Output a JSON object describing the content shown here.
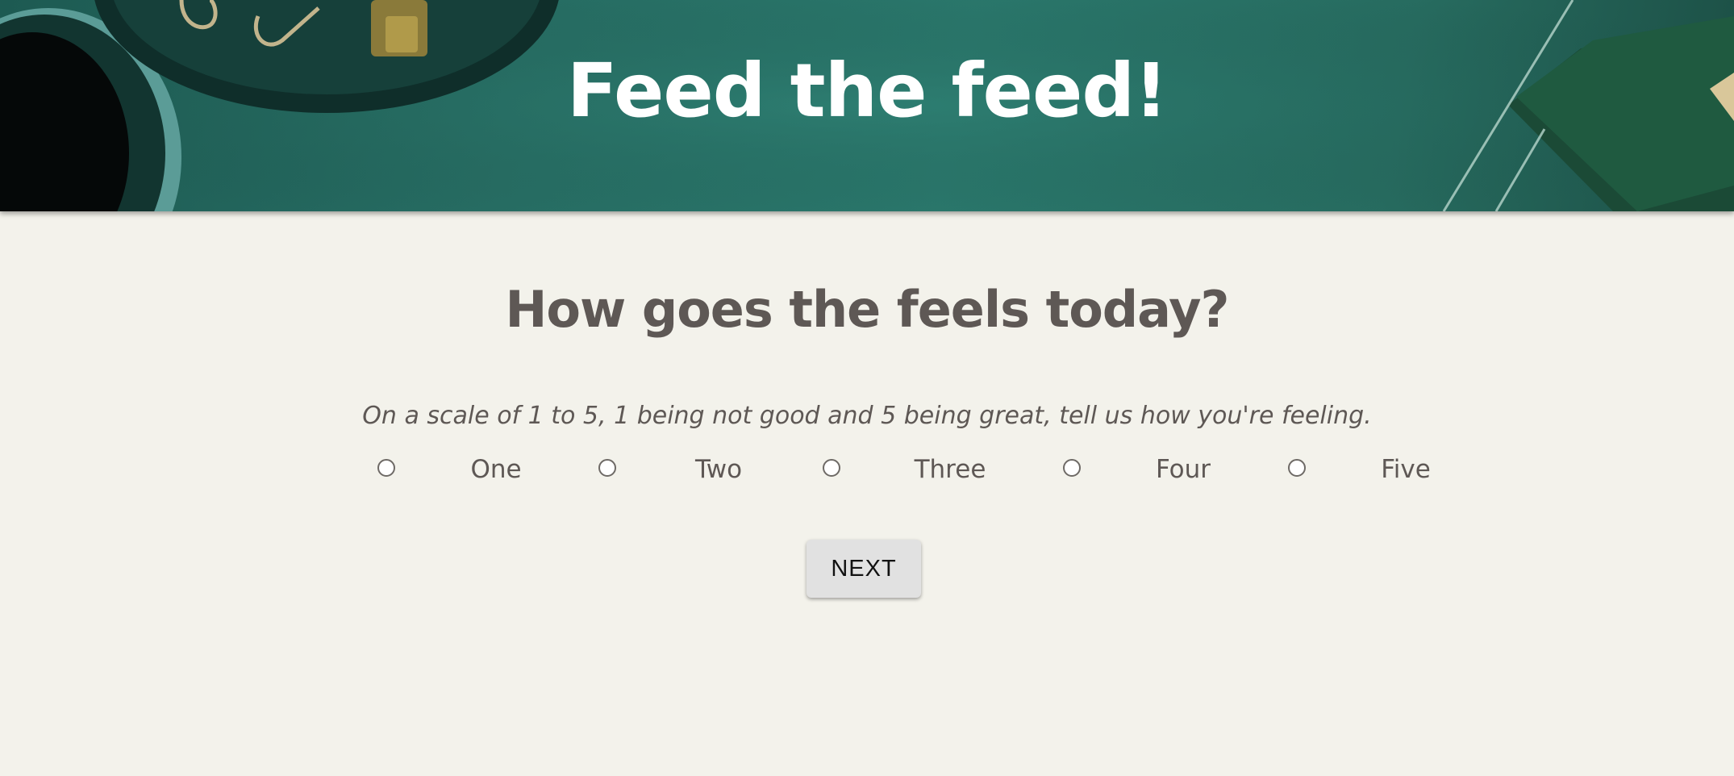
{
  "header": {
    "title": "Feed the feed!"
  },
  "survey": {
    "question": "How goes the feels today?",
    "instructions": "On a scale of 1 to 5, 1 being not good and 5 being great, tell us how you're feeling.",
    "options": [
      {
        "label": "One",
        "selected": false
      },
      {
        "label": "Two",
        "selected": false
      },
      {
        "label": "Three",
        "selected": false
      },
      {
        "label": "Four",
        "selected": false
      },
      {
        "label": "Five",
        "selected": false
      }
    ],
    "next_label": "NEXT"
  },
  "colors": {
    "header_bg": "#2b7a6e",
    "page_bg": "#f3f2eb",
    "text": "#5e5855",
    "button_bg": "#e1e1e1"
  }
}
